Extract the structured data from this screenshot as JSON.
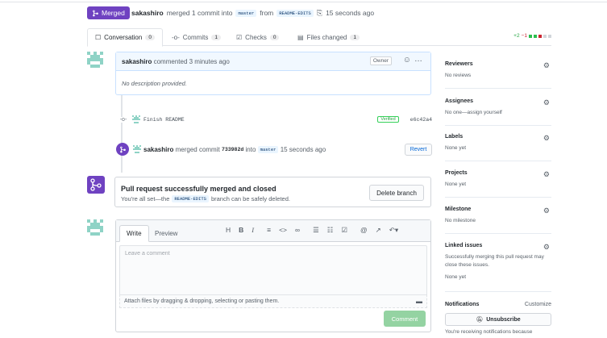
{
  "header": {
    "status_label": "Merged",
    "author": "sakashiro",
    "action_text": "merged 1 commit into",
    "base_branch": "master",
    "from_text": "from",
    "head_branch": "README-EDITS",
    "time": "15 seconds ago"
  },
  "tabs": [
    {
      "label": "Conversation",
      "count": "0"
    },
    {
      "label": "Commits",
      "count": "1"
    },
    {
      "label": "Checks",
      "count": "0"
    },
    {
      "label": "Files changed",
      "count": "1"
    }
  ],
  "diffstat": {
    "additions": "+2",
    "deletions": "−1"
  },
  "comment": {
    "author": "sakashiro",
    "meta": "commented 3 minutes ago",
    "badge": "Owner",
    "body": "No description provided."
  },
  "commit": {
    "message": "Finish README",
    "verified": "Verified",
    "sha": "e6c42a4"
  },
  "merge_event": {
    "author": "sakashiro",
    "text_before": "merged commit",
    "sha": "733982d",
    "text_into": "into",
    "branch": "master",
    "time": "15 seconds ago",
    "revert_label": "Revert"
  },
  "merged_box": {
    "title": "Pull request successfully merged and closed",
    "desc_before": "You're all set—the",
    "branch": "README-EDITS",
    "desc_after": "branch can be safely deleted.",
    "delete_label": "Delete branch"
  },
  "editor": {
    "write_tab": "Write",
    "preview_tab": "Preview",
    "placeholder": "Leave a comment",
    "attach_text": "Attach files by dragging & dropping, selecting or pasting them.",
    "comment_label": "Comment"
  },
  "sidebar": {
    "reviewers": {
      "title": "Reviewers",
      "value": "No reviews"
    },
    "assignees": {
      "title": "Assignees",
      "value": "No one—assign yourself"
    },
    "labels": {
      "title": "Labels",
      "value": "None yet"
    },
    "projects": {
      "title": "Projects",
      "value": "None yet"
    },
    "milestone": {
      "title": "Milestone",
      "value": "No milestone"
    },
    "linked_issues": {
      "title": "Linked issues",
      "value": "Successfully merging this pull request may close these issues.",
      "value2": "None yet"
    },
    "notifications": {
      "title": "Notifications",
      "customize": "Customize",
      "unsubscribe_label": "Unsubscribe",
      "footer": "You're receiving notifications because"
    }
  },
  "colors": {
    "merged": "#6f42c1",
    "link": "#0366d6",
    "green": "#28a745",
    "red": "#cb2431"
  }
}
